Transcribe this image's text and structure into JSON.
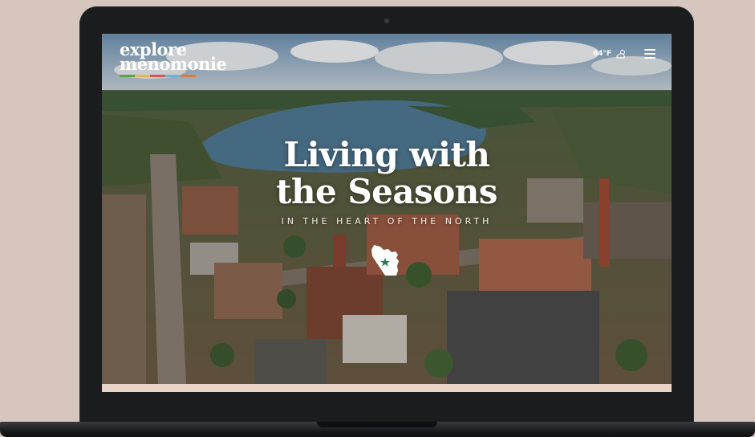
{
  "site": {
    "logo_line1": "explore",
    "logo_line2": "menomonie",
    "logo_stripe_colors": [
      "#5aa54a",
      "#e6b84a",
      "#d9534f",
      "#6fb3d6",
      "#e07a3c"
    ]
  },
  "header": {
    "temperature": "64°F",
    "weather_icon": "partly-cloudy-icon",
    "menu_icon": "hamburger-menu-icon"
  },
  "hero": {
    "headline_line1": "Living with",
    "headline_line2": "the Seasons",
    "tagline": "IN THE HEART OF THE NORTH",
    "state_icon": "wisconsin-map-icon",
    "accent_color": "#2d7a4f"
  },
  "device": {
    "frame_color": "#1b1c1e",
    "backdrop_color": "#d7c6bd"
  }
}
